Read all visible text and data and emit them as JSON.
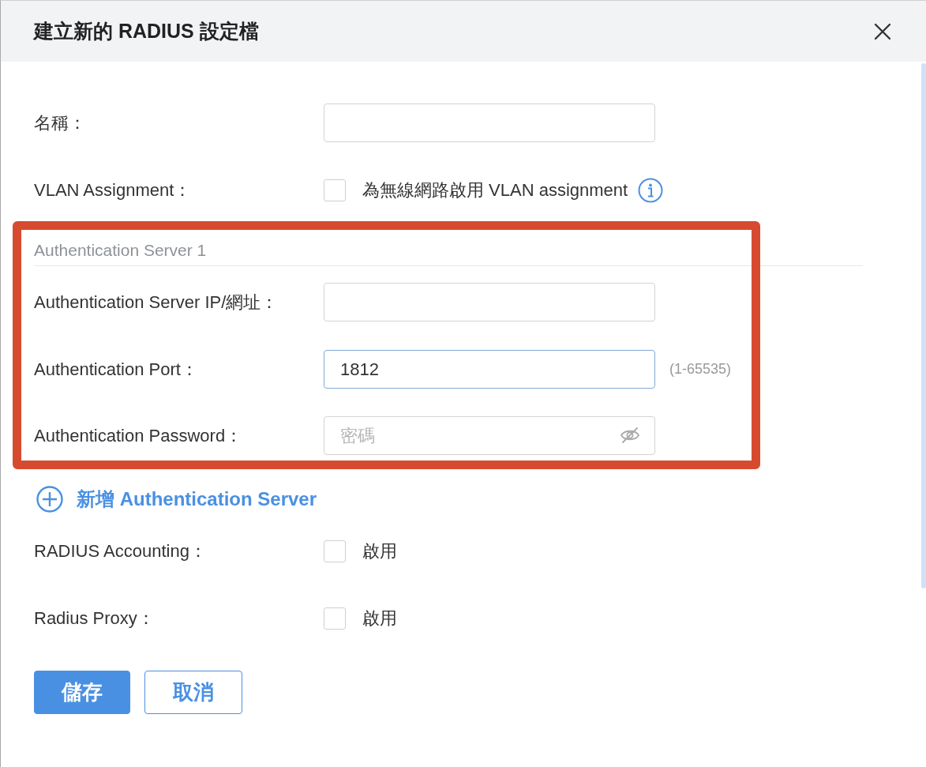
{
  "dialog": {
    "title": "建立新的 RADIUS 設定檔"
  },
  "form": {
    "rows": [
      {
        "kind": "text",
        "label": "名稱：",
        "focused": false
      },
      {
        "kind": "checkbox",
        "label": "VLAN Assignment：",
        "option": "為無線網路啟用 VLAN assignment",
        "checked": false,
        "info_icon": true
      }
    ]
  },
  "server_section": {
    "heading": "Authentication Server 1",
    "highlighted": true,
    "rows": [
      {
        "kind": "text",
        "label": "Authentication Server IP/網址：",
        "focused": false
      },
      {
        "kind": "text",
        "label": "Authentication Port：",
        "value": "1812",
        "focused": true,
        "hint": "(1-65535)"
      },
      {
        "kind": "password",
        "label": "Authentication Password：",
        "placeholder": "密碼",
        "focused": false
      }
    ]
  },
  "add_server_link": {
    "label": "新增 Authentication Server"
  },
  "options": {
    "rows": [
      {
        "kind": "checkbox",
        "label": "RADIUS Accounting：",
        "option": "啟用",
        "checked": false
      },
      {
        "kind": "checkbox",
        "label": "Radius Proxy：",
        "option": "啟用",
        "checked": false
      }
    ]
  },
  "buttons": [
    {
      "kind": "primary",
      "label": "儲存"
    },
    {
      "kind": "secondary",
      "label": "取消"
    }
  ]
}
